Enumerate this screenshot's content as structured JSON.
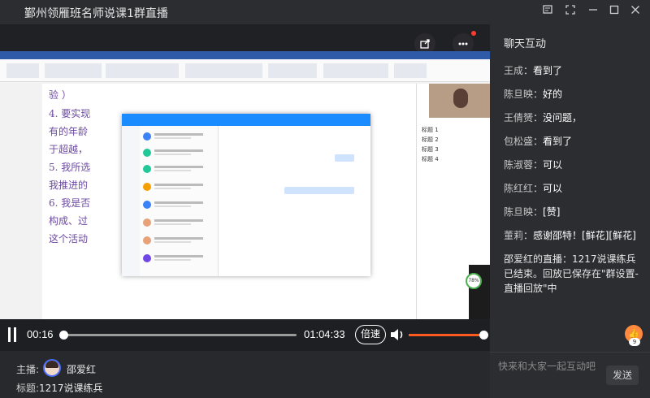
{
  "window": {
    "title": "鄞州领雁班名师说课1群直播"
  },
  "player": {
    "current_time": "00:16",
    "duration": "01:04:33",
    "progress": 0.004,
    "speed_label": "倍速",
    "volume": 1.0
  },
  "host": {
    "host_label": "主播:",
    "host_name": "邵爱红",
    "title_label": "标题:",
    "title_value": "1217说课练兵"
  },
  "chat": {
    "title": "聊天互动",
    "messages": [
      {
        "name": "王成",
        "text": "看到了"
      },
      {
        "name": "陈旦映",
        "text": "好的"
      },
      {
        "name": "王倩赟",
        "text": "没问题，"
      },
      {
        "name": "包松盛",
        "text": "看到了"
      },
      {
        "name": "陈淑蓉",
        "text": "可以"
      },
      {
        "name": "陈红红",
        "text": "可以"
      },
      {
        "name": "陈旦映",
        "text": "[赞]"
      },
      {
        "name": "董莉",
        "text": "感谢邵特！[鲜花][鲜花]"
      }
    ],
    "system_message": "邵爱红的直播：1217说课练兵 已结束。回放已保存在\"群设置-直播回放\"中",
    "like_count": "9",
    "input_placeholder": "快来和大家一起互动吧",
    "send_label": "发送"
  },
  "screen": {
    "doc_lines": [
      "验 ）",
      "4. 要实现",
      "有的年龄",
      "于超越，",
      "5. 我所选",
      "我推进的",
      "6. 我是否",
      "构成、过",
      "这个活动"
    ],
    "outline_items": [
      "标题 1",
      "标题 2",
      "标题 3",
      "标题 4"
    ],
    "progress_badge": "78%"
  },
  "colors": {
    "accent": "#ff5a1f",
    "background": "#27292d",
    "chat_bg": "#2b2d31"
  }
}
